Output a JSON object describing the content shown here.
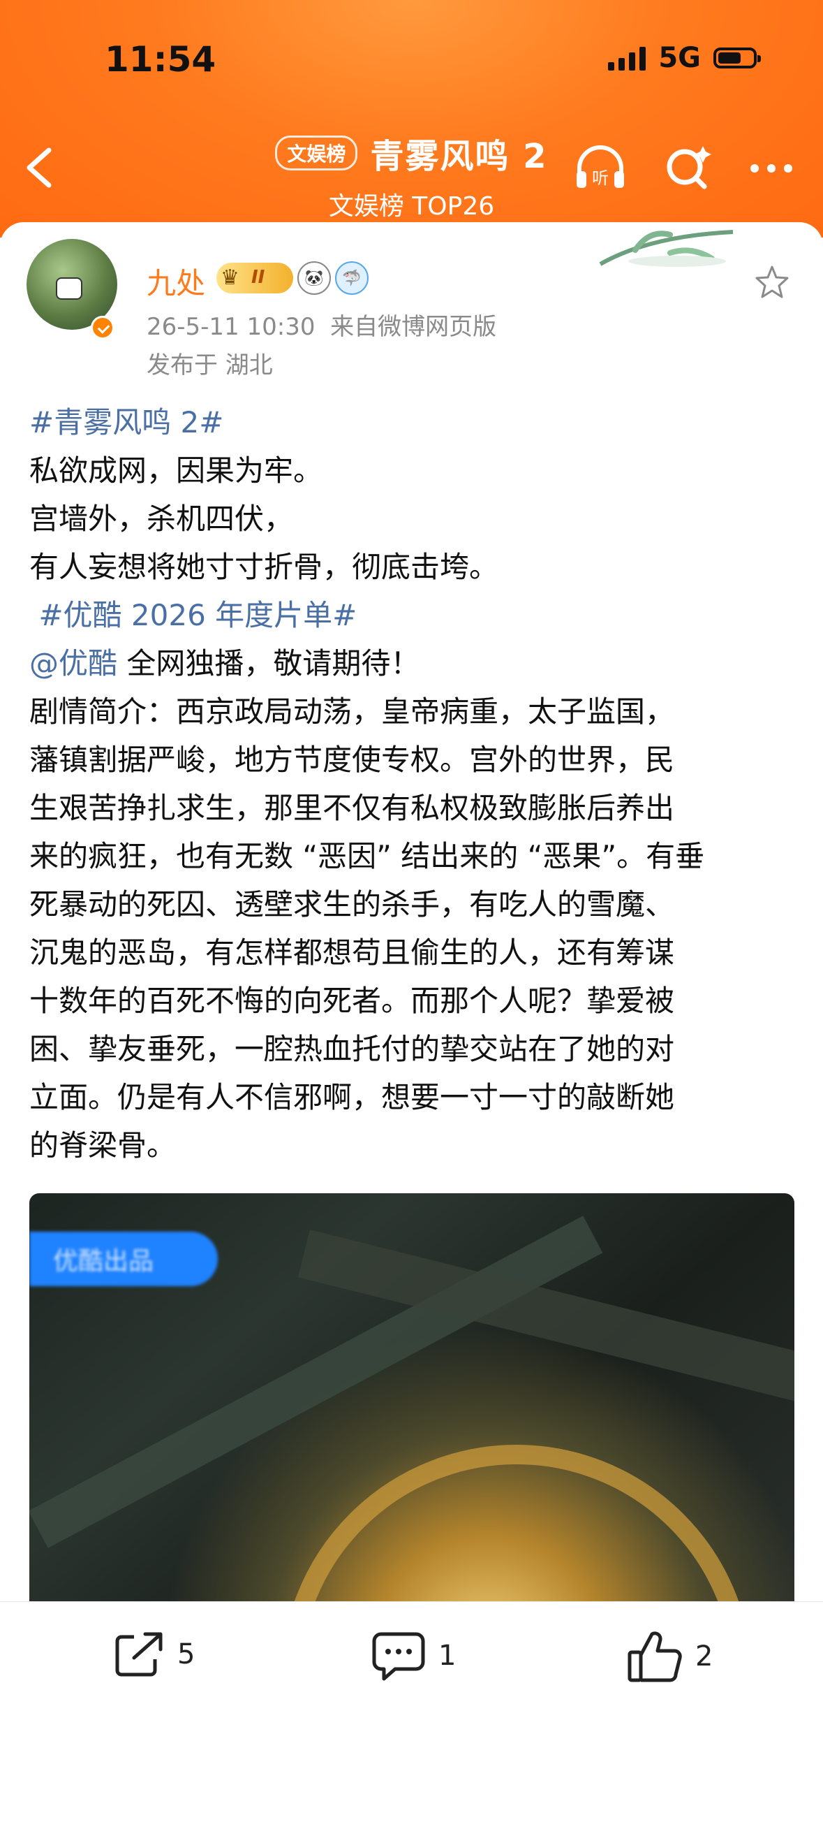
{
  "status_bar": {
    "time": "11:54",
    "network": "5G"
  },
  "header": {
    "badge": "文娱榜",
    "title": "青雾风鸣 2",
    "subtitle": "文娱榜 TOP26",
    "icons": [
      "back-icon",
      "listen-icon",
      "search-icon",
      "more-icon"
    ],
    "listen_label": "听"
  },
  "post": {
    "author": "九处",
    "level": "II",
    "timestamp": "26-5-11 10:30",
    "source": "来自微博网页版",
    "location": "发布于 湖北",
    "content": {
      "hashtag1": "#青雾风鸣 2#",
      "line1": "私欲成网，因果为牢。",
      "line2": "宫墙外，杀机四伏，",
      "line3": "有人妄想将她寸寸折骨，彻底击垮。",
      "hashtag2": "#优酷 2026 年度片单#",
      "mention": "@优酷",
      "line4": " 全网独播，敬请期待！",
      "p1": "剧情简介：西京政局动荡，皇帝病重，太子监国，",
      "p2": "藩镇割据严峻，地方节度使专权。宫外的世界，民",
      "p3": "生艰苦挣扎求生，那里不仅有私权极致膨胀后养出",
      "p4": "来的疯狂，也有无数 “恶因” 结出来的 “恶果”。有垂",
      "p5": "死暴动的死囚、透壁求生的杀手，有吃人的雪魔、",
      "p6": "沉鬼的恶岛，有怎样都想苟且偷生的人，还有筹谋",
      "p7": "十数年的百死不悔的向死者。而那个人呢？挚爱被",
      "p8": "困、挚友垂死，一腔热血托付的挚交站在了她的对",
      "p9": "立面。仍是有人不信邪啊，想要一寸一寸的敲断她",
      "p10": "的脊梁骨。"
    },
    "media_label": "优酷出品"
  },
  "toolbar": {
    "share_count": "5",
    "comment_count": "1",
    "like_count": "2"
  },
  "colors": {
    "accent": "#ff7a1c",
    "link": "#4a6fa5",
    "header_bg": "#ff7a1e"
  }
}
